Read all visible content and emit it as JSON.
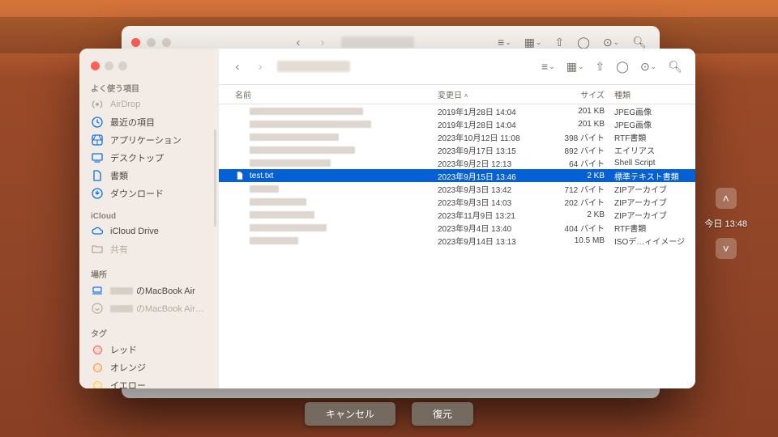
{
  "sidebar": {
    "sections": {
      "favorites_label": "よく使う項目",
      "icloud_label": "iCloud",
      "locations_label": "場所",
      "tags_label": "タグ"
    },
    "favorites": [
      {
        "label": "AirDrop",
        "icon": "airdrop",
        "faded": true
      },
      {
        "label": "最近の項目",
        "icon": "clock",
        "faded": false
      },
      {
        "label": "アプリケーション",
        "icon": "apps",
        "faded": false
      },
      {
        "label": "デスクトップ",
        "icon": "desktop",
        "faded": false
      },
      {
        "label": "書類",
        "icon": "doc",
        "faded": false
      },
      {
        "label": "ダウンロード",
        "icon": "download",
        "faded": false
      }
    ],
    "icloud": [
      {
        "label": "iCloud Drive",
        "icon": "cloud",
        "faded": false
      },
      {
        "label": "共有",
        "icon": "folder",
        "faded": true
      }
    ],
    "locations": [
      {
        "label": "のMacBook Air",
        "icon": "laptop",
        "blurprefix": true,
        "faded": false
      },
      {
        "label": "のMacBook Air…",
        "icon": "time",
        "blurprefix": true,
        "faded": true
      }
    ],
    "tags": [
      {
        "label": "レッド",
        "color": "#ff5b4d"
      },
      {
        "label": "オレンジ",
        "color": "#ff9a3c"
      },
      {
        "label": "イエロー",
        "color": "#ffd23c"
      }
    ]
  },
  "columns": {
    "name": "名前",
    "modified": "変更日",
    "size": "サイズ",
    "kind": "種類"
  },
  "files": [
    {
      "name": "",
      "blurred": true,
      "blurw": 140,
      "date": "2019年1月28日 14:04",
      "size": "201 KB",
      "kind": "JPEG画像",
      "sel": false,
      "icon": "generic"
    },
    {
      "name": "",
      "blurred": true,
      "blurw": 150,
      "date": "2019年1月28日 14:04",
      "size": "201 KB",
      "kind": "JPEG画像",
      "sel": false,
      "icon": "generic"
    },
    {
      "name": "",
      "blurred": true,
      "blurw": 110,
      "date": "2023年10月12日 11:08",
      "size": "398 バイト",
      "kind": "RTF書類",
      "sel": false,
      "icon": "generic"
    },
    {
      "name": "",
      "blurred": true,
      "blurw": 130,
      "date": "2023年9月17日 13:15",
      "size": "892 バイト",
      "kind": "エイリアス",
      "sel": false,
      "icon": "generic"
    },
    {
      "name": "",
      "blurred": true,
      "blurw": 100,
      "date": "2023年9月2日 12:13",
      "size": "64 バイト",
      "kind": "Shell Script",
      "sel": false,
      "icon": "generic"
    },
    {
      "name": "test.txt",
      "blurred": false,
      "date": "2023年9月15日 13:46",
      "size": "2 KB",
      "kind": "標準テキスト書類",
      "sel": true,
      "icon": "doc"
    },
    {
      "name": "",
      "blurred": true,
      "blurw": 36,
      "date": "2023年9月3日 13:42",
      "size": "712 バイト",
      "kind": "ZIPアーカイブ",
      "sel": false,
      "icon": "generic"
    },
    {
      "name": "",
      "blurred": true,
      "blurw": 70,
      "date": "2023年9月3日 14:03",
      "size": "202 バイト",
      "kind": "ZIPアーカイブ",
      "sel": false,
      "icon": "generic"
    },
    {
      "name": "",
      "blurred": true,
      "blurw": 80,
      "date": "2023年11月9日 13:21",
      "size": "2 KB",
      "kind": "ZIPアーカイブ",
      "sel": false,
      "icon": "generic"
    },
    {
      "name": "",
      "blurred": true,
      "blurw": 95,
      "date": "2023年9月4日 13:40",
      "size": "404 バイト",
      "kind": "RTF書類",
      "sel": false,
      "icon": "generic"
    },
    {
      "name": "",
      "blurred": true,
      "blurw": 60,
      "date": "2023年9月14日 13:13",
      "size": "10.5 MB",
      "kind": "ISOデ…ィイメージ",
      "sel": false,
      "icon": "generic"
    }
  ],
  "timeline": {
    "label": "今日 13:48"
  },
  "buttons": {
    "cancel": "キャンセル",
    "restore": "復元"
  }
}
